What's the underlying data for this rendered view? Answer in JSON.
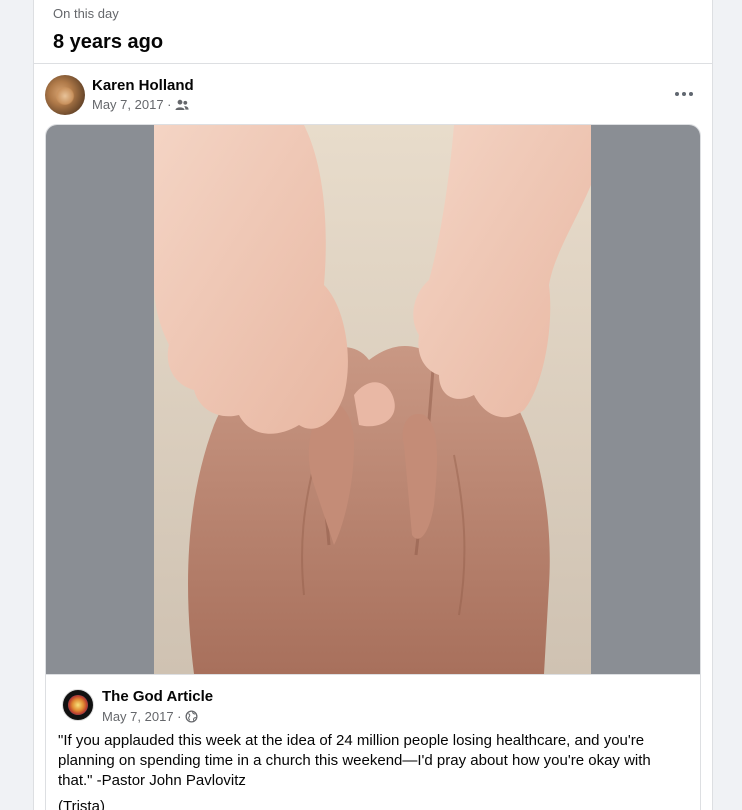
{
  "memory": {
    "label": "On this day",
    "years_ago": "8 years ago"
  },
  "post": {
    "author": "Karen Holland",
    "date": "May 7, 2017 ·",
    "audience_icon": "friends-icon"
  },
  "shared": {
    "page_name": "The God Article",
    "date": "May 7, 2017 ·",
    "audience_icon": "globe-icon",
    "text": "\"If you applauded this week at the idea of 24 million people losing healthcare, and you're planning on spending time in a church this weekend—I'd pray about how you're okay with that.\" -Pastor John Pavlovitz",
    "credit": "(Trista)"
  }
}
